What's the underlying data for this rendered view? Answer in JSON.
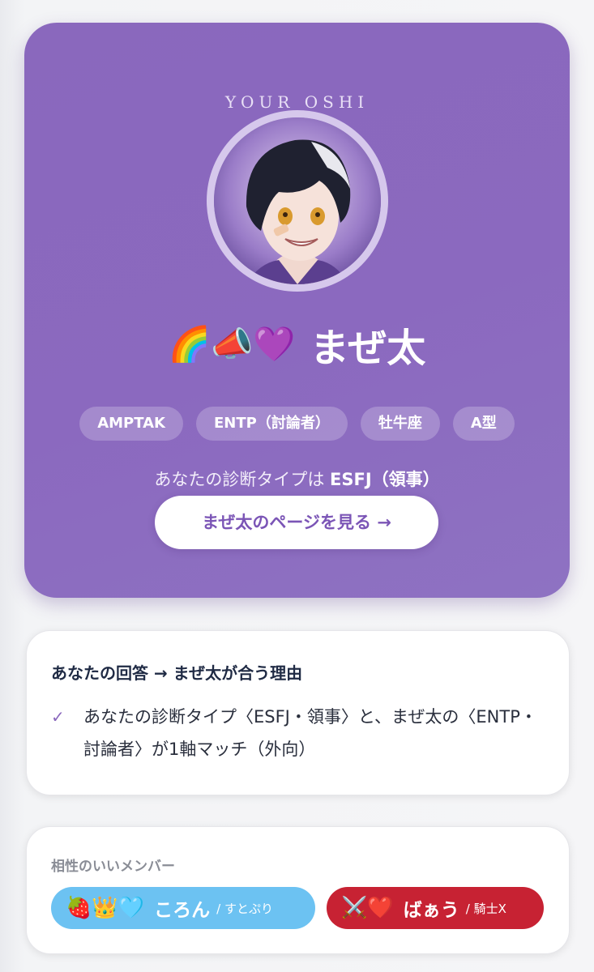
{
  "hero": {
    "eyebrow": "YOUR OSHI",
    "avatar_alt": "まぜ太",
    "name_emoji": "🌈📣💜",
    "name": "まぜ太",
    "tags": [
      "AMPTAK",
      "ENTP（討論者）",
      "牡牛座",
      "A型"
    ],
    "diagnosis_prefix": "あなたの診断タイプは",
    "diagnosis_type": "ESFJ（領事）",
    "cta_label": "まぜ太のページを見る →"
  },
  "reason": {
    "title": "あなたの回答 → まぜ太が合う理由",
    "check_icon": "✓",
    "items": [
      "あなたの診断タイプ〈ESFJ・領事〉と、まぜ太の〈ENTP・討論者〉が1軸マッチ（外向）"
    ]
  },
  "members": {
    "label": "相性のいいメンバー",
    "list": [
      {
        "emoji": "🍓👑🩵",
        "name": "ころん",
        "group": "/ すとぷり",
        "color": "#6cc2f2"
      },
      {
        "emoji": "⚔️❤️",
        "name": "ばぁう",
        "group": "/ 騎士X",
        "color": "#c72233"
      }
    ]
  },
  "colors": {
    "hero_bg": "#8a68bd",
    "accent": "#7b55b6",
    "heading": "#1f2a44"
  }
}
